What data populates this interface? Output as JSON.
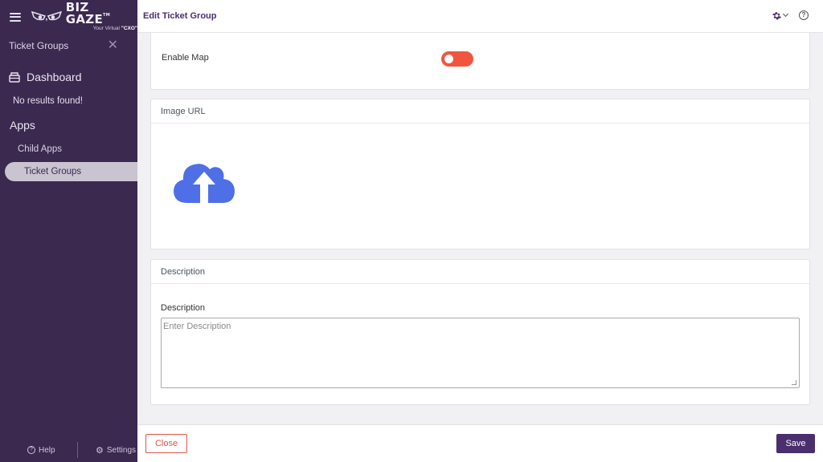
{
  "app": {
    "brand_name": "BIZ GAZE",
    "brand_tm": "TM",
    "brand_tag_prefix": "Your Virtual ",
    "brand_tag_strong": "\"CXO\"",
    "logo_icon": "owl-eyes-logo"
  },
  "sidebar": {
    "module_title": "Ticket Groups",
    "close_icon": "close-icon",
    "dashboard_label": "Dashboard",
    "no_results": "No results found!",
    "apps_heading": "Apps",
    "items": [
      {
        "label": "Child Apps",
        "active": false
      },
      {
        "label": "Ticket Groups",
        "active": true
      }
    ],
    "footer": {
      "help_label": "Help",
      "settings_label": "Settings"
    }
  },
  "header": {
    "title": "Edit Ticket Group",
    "gear_icon": "gear-icon",
    "help_icon": "help-circle-icon"
  },
  "form": {
    "enable_map": {
      "label": "Enable Map",
      "enabled": false,
      "color": "#f0553f"
    },
    "image_section": {
      "title": "Image URL",
      "icon": "cloud-upload-icon",
      "icon_color": "#4f6fe6"
    },
    "description_section": {
      "title": "Description",
      "field_label": "Description",
      "placeholder": "Enter Description",
      "value": ""
    }
  },
  "footer": {
    "close_label": "Close",
    "save_label": "Save",
    "accent": "#4b2e6d"
  }
}
